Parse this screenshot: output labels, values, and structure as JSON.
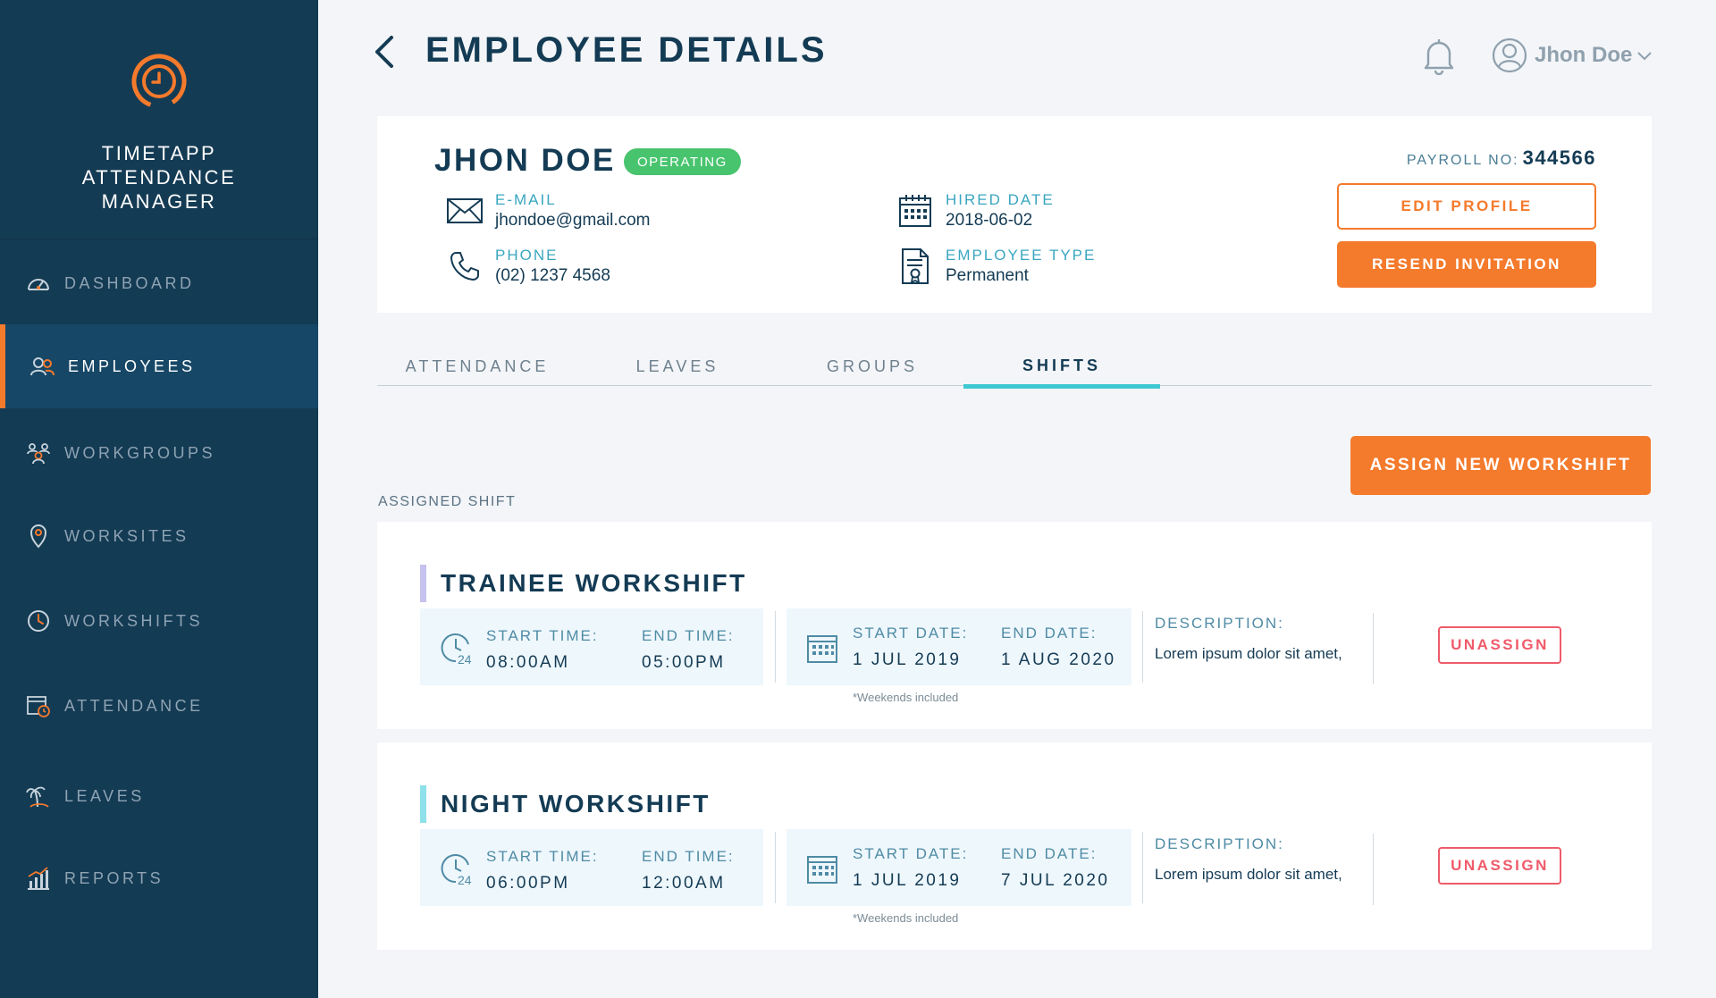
{
  "app": {
    "name": "TIMETAPP ATTENDANCE MANAGER",
    "accent": "#f47a2c",
    "sidebar_bg": "#143b54"
  },
  "sidebar": {
    "items": [
      {
        "label": "DASHBOARD",
        "icon": "speedometer-icon",
        "active": false
      },
      {
        "label": "EMPLOYEES",
        "icon": "users-icon",
        "active": true
      },
      {
        "label": "WORKGROUPS",
        "icon": "group-icon",
        "active": false
      },
      {
        "label": "WORKSITES",
        "icon": "map-pin-icon",
        "active": false
      },
      {
        "label": "WORKSHIFTS",
        "icon": "clock-icon",
        "active": false
      },
      {
        "label": "ATTENDANCE",
        "icon": "calendar-clock-icon",
        "active": false
      },
      {
        "label": "LEAVES",
        "icon": "palm-tree-icon",
        "active": false
      },
      {
        "label": "REPORTS",
        "icon": "bar-chart-icon",
        "active": false
      }
    ]
  },
  "header": {
    "title": "EMPLOYEE DETAILS",
    "user_name": "Jhon Doe"
  },
  "profile": {
    "name": "JHON DOE",
    "status": "OPERATING",
    "status_color": "#48c46e",
    "email_label": "E-MAIL",
    "email": "jhondoe@gmail.com",
    "phone_label": "PHONE",
    "phone": "(02) 1237 4568",
    "hired_label": "HIRED DATE",
    "hired": "2018-06-02",
    "type_label": "EMPLOYEE TYPE",
    "type": "Permanent",
    "payroll_label": "PAYROLL NO:",
    "payroll": "344566",
    "edit_label": "EDIT PROFILE",
    "resend_label": "RESEND INVITATION"
  },
  "tabs": [
    {
      "label": "ATTENDANCE",
      "active": false
    },
    {
      "label": "LEAVES",
      "active": false
    },
    {
      "label": "GROUPS",
      "active": false
    },
    {
      "label": "SHIFTS",
      "active": true
    }
  ],
  "shifts_section": {
    "assign_label": "ASSIGN NEW WORKSHIFT",
    "assigned_label": "ASSIGNED SHIFT"
  },
  "shifts": [
    {
      "title": "TRAINEE WORKSHIFT",
      "start_time_label": "START TIME:",
      "start_time": "08:00AM",
      "end_time_label": "END TIME:",
      "end_time": "05:00PM",
      "start_date_label": "START DATE:",
      "start_date": "1 JUL 2019",
      "end_date_label": "END DATE:",
      "end_date": "1 AUG 2020",
      "note": "*Weekends included",
      "desc_label": "DESCRIPTION:",
      "desc": "Lorem ipsum dolor sit amet,",
      "unassign_label": "UNASSIGN"
    },
    {
      "title": "NIGHT WORKSHIFT",
      "start_time_label": "START TIME:",
      "start_time": "06:00PM",
      "end_time_label": "END TIME:",
      "end_time": "12:00AM",
      "start_date_label": "START DATE:",
      "start_date": "1 JUL 2019",
      "end_date_label": "END DATE:",
      "end_date": "7 JUL 2020",
      "note": "*Weekends included",
      "desc_label": "DESCRIPTION:",
      "desc": "Lorem ipsum dolor sit amet,",
      "unassign_label": "UNASSIGN"
    }
  ]
}
